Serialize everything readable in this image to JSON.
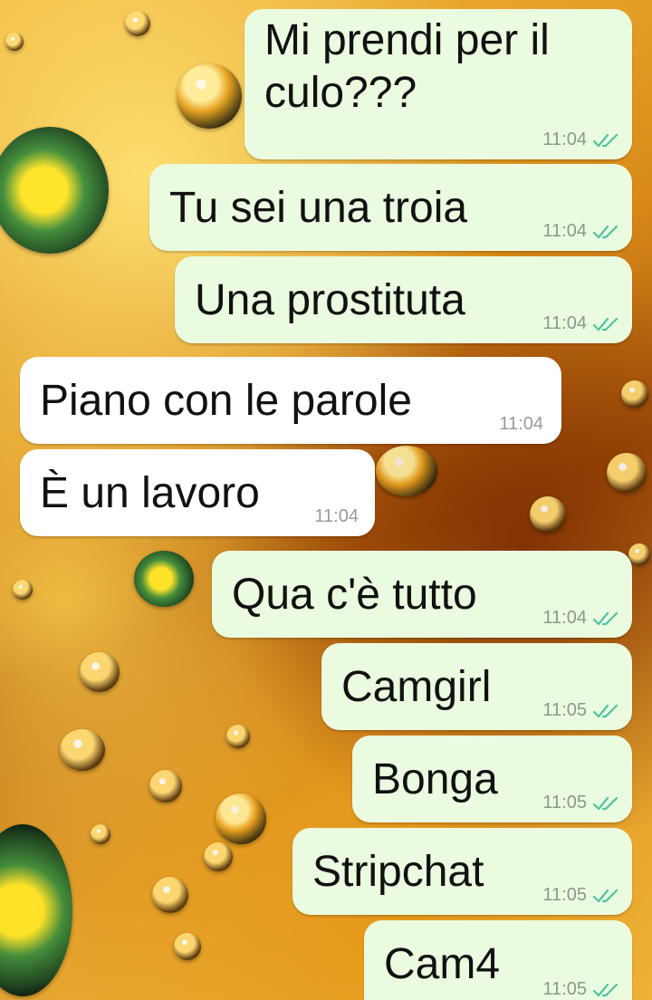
{
  "theme": {
    "outgoing_bubble_color": "#eafbe0",
    "incoming_bubble_color": "#ffffff",
    "read_tick_color": "#4fc3a1",
    "wallpaper": "orange water droplets"
  },
  "messages": [
    {
      "direction": "out",
      "text": "Mi prendi per il culo???",
      "time": "11:04",
      "status_icon": "double-check-icon"
    },
    {
      "direction": "out",
      "text": "Tu sei una troia",
      "time": "11:04",
      "status_icon": "double-check-icon"
    },
    {
      "direction": "out",
      "text": "Una prostituta",
      "time": "11:04",
      "status_icon": "double-check-icon"
    },
    {
      "direction": "in",
      "text": "Piano con le parole",
      "time": "11:04"
    },
    {
      "direction": "in",
      "text": "È un lavoro",
      "time": "11:04"
    },
    {
      "direction": "out",
      "text": "Qua c'è tutto",
      "time": "11:04",
      "status_icon": "double-check-icon"
    },
    {
      "direction": "out",
      "text": "Camgirl",
      "time": "11:05",
      "status_icon": "double-check-icon"
    },
    {
      "direction": "out",
      "text": "Bonga",
      "time": "11:05",
      "status_icon": "double-check-icon"
    },
    {
      "direction": "out",
      "text": "Stripchat",
      "time": "11:05",
      "status_icon": "double-check-icon"
    },
    {
      "direction": "out",
      "text": "Cam4",
      "time": "11:05",
      "status_icon": "double-check-icon"
    }
  ]
}
